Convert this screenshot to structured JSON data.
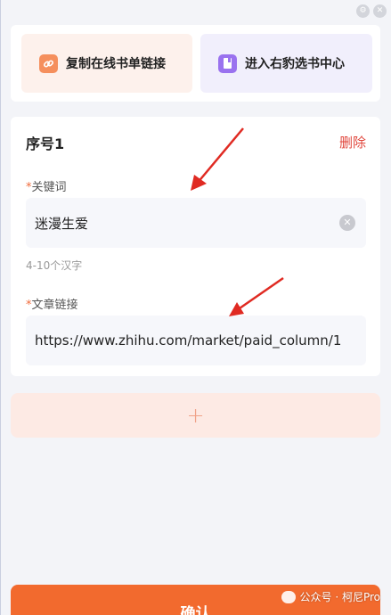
{
  "window": {
    "controls": [
      "settings-icon",
      "close-icon"
    ]
  },
  "shortcuts": {
    "copy_label": "复制在线书单链接",
    "copy_icon": "link-icon",
    "enter_label": "进入右豹选书中心",
    "enter_icon": "book-icon"
  },
  "entry": {
    "title": "序号1",
    "delete_label": "删除",
    "keyword": {
      "required_mark": "*",
      "label": "关键词",
      "value": "迷漫生爱",
      "hint": "4-10个汉字"
    },
    "link": {
      "required_mark": "*",
      "label": "文章链接",
      "value": "https://www.zhihu.com/market/paid_column/1"
    }
  },
  "add_button": {
    "label": "+"
  },
  "confirm_button": {
    "label": "确认"
  },
  "watermark": {
    "text": "公众号 · 柯尼Pro"
  },
  "colors": {
    "accent": "#f26a2e",
    "danger": "#e0453b",
    "arrow": "#e02a22"
  }
}
